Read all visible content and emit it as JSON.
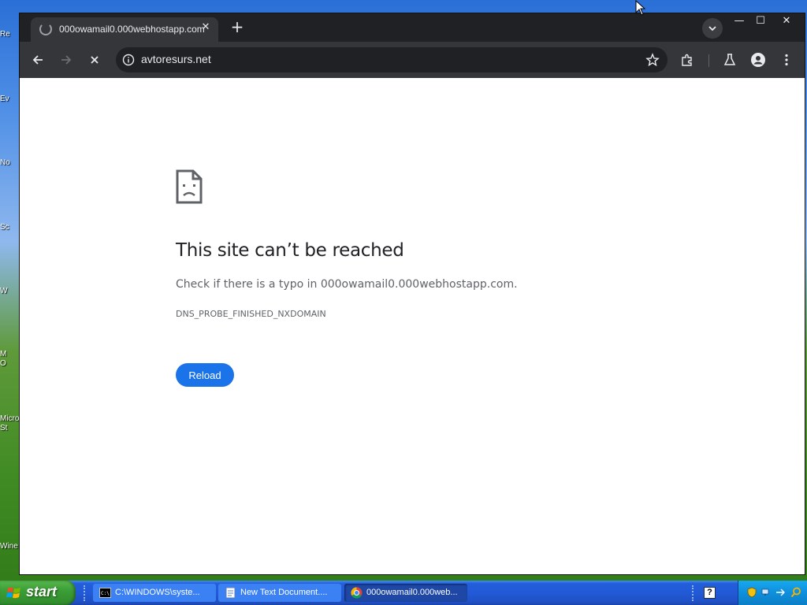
{
  "desktop": {
    "icons": [
      "Re",
      "Ev",
      "No",
      "Sc",
      "W",
      "M\nO",
      "Micro\nSt",
      "Wine"
    ]
  },
  "browser": {
    "tab": {
      "title": "000owamail0.000webhostapp.com",
      "close_glyph": "✕"
    },
    "new_tab_glyph": "+",
    "window_controls": {
      "minimize": "—",
      "maximize": "☐",
      "close": "✕"
    },
    "omnibox": {
      "url": "avtoresurs.net"
    }
  },
  "error_page": {
    "title": "This site can’t be reached",
    "message": "Check if there is a typo in 000owamail0.000webhostapp.com.",
    "code": "DNS_PROBE_FINISHED_NXDOMAIN",
    "reload_label": "Reload"
  },
  "taskbar": {
    "start_label": "start",
    "tasks": [
      {
        "label": "C:\\WINDOWS\\syste...",
        "icon": "cmd-icon"
      },
      {
        "label": "New Text Document....",
        "icon": "notepad-icon"
      },
      {
        "label": "000owamail0.000web...",
        "icon": "chrome-icon"
      }
    ]
  },
  "colors": {
    "accent": "#1a73e8",
    "browser_frame": "#202124",
    "toolbar": "#35363a"
  }
}
